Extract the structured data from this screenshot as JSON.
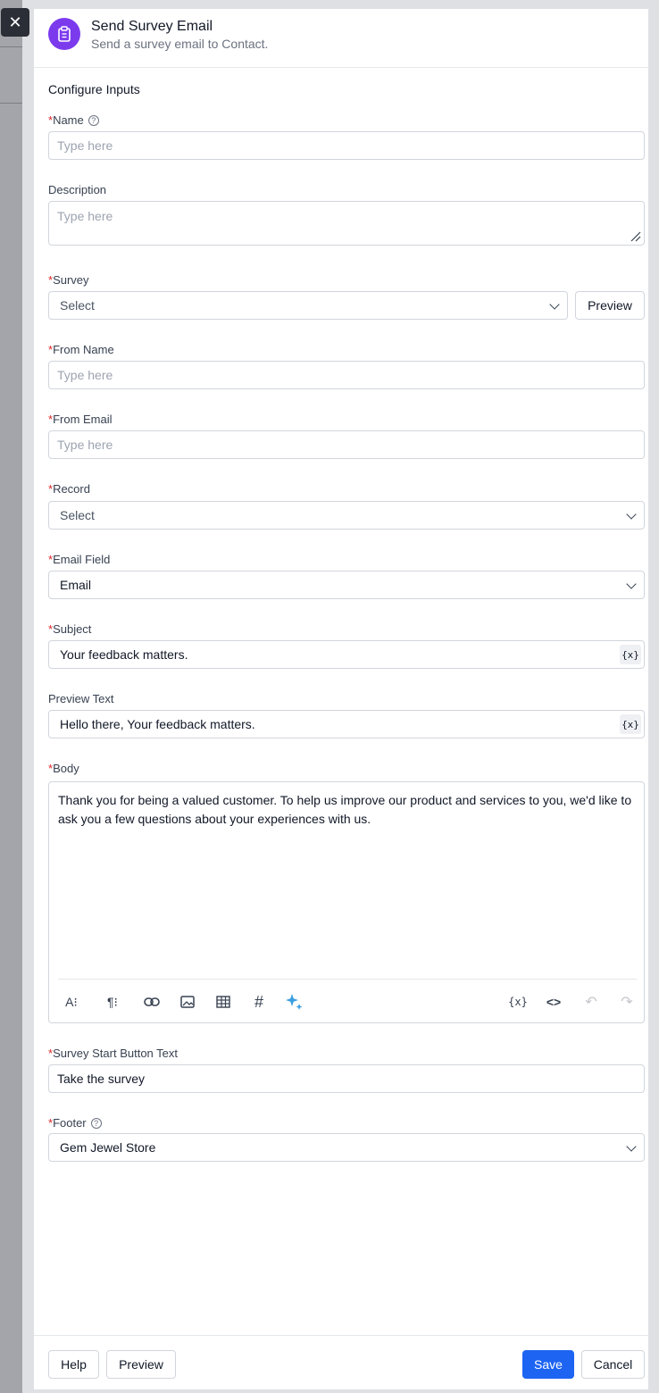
{
  "header": {
    "title": "Send Survey Email",
    "subtitle": "Send a survey email to Contact."
  },
  "section_title": "Configure Inputs",
  "fields": {
    "name": {
      "label": "Name",
      "placeholder": "Type here"
    },
    "description": {
      "label": "Description",
      "placeholder": "Type here"
    },
    "survey": {
      "label": "Survey",
      "value": "Select",
      "preview_label": "Preview"
    },
    "from_name": {
      "label": "From Name",
      "placeholder": "Type here"
    },
    "from_email": {
      "label": "From Email",
      "placeholder": "Type here"
    },
    "record": {
      "label": "Record",
      "value": "Select"
    },
    "email_field": {
      "label": "Email Field",
      "value": "Email"
    },
    "subject": {
      "label": "Subject",
      "value": "Your feedback matters."
    },
    "preview_text": {
      "label": "Preview Text",
      "value": "Hello there, Your feedback matters."
    },
    "body": {
      "label": "Body",
      "value": "Thank you for being a valued customer. To help us improve our product and services to you, we'd like to ask you a few questions about your experiences with us."
    },
    "start_button_text": {
      "label": "Survey Start Button Text",
      "value": "Take the survey"
    },
    "footer": {
      "label": "Footer",
      "value": "Gem Jewel Store"
    }
  },
  "required_marker": "*",
  "variable_glyph": "{x}",
  "toolbar_icons": [
    "text-size-icon",
    "paragraph-icon",
    "link-icon",
    "image-icon",
    "table-icon",
    "hash-icon",
    "ai-sparkle-icon",
    "variable-icon",
    "code-icon",
    "undo-icon",
    "redo-icon"
  ],
  "footer_buttons": {
    "help": "Help",
    "preview": "Preview",
    "save": "Save",
    "cancel": "Cancel"
  },
  "colors": {
    "accent": "#7c3aed",
    "primary": "#1d64f2",
    "required": "#dc2626",
    "sparkle": "#3b9fe0"
  }
}
